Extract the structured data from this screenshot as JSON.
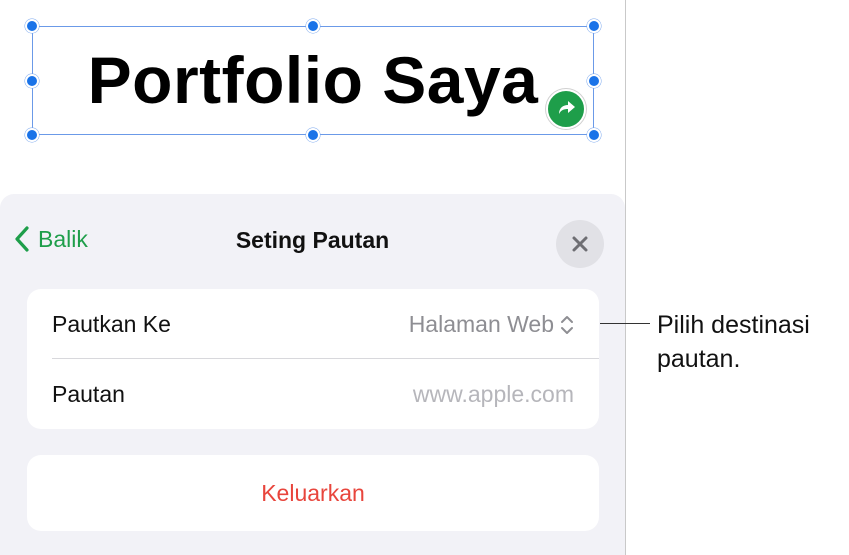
{
  "canvas": {
    "title": "Portfolio Saya",
    "link_badge_icon": "arrow-forward-icon"
  },
  "sheet": {
    "back_label": "Balik",
    "title": "Seting Pautan",
    "close_icon": "close-icon",
    "rows": [
      {
        "label": "Pautkan Ke",
        "value": "Halaman Web",
        "value_icon": "up-down-chevron-icon"
      },
      {
        "label": "Pautan",
        "placeholder": "www.apple.com"
      }
    ],
    "remove_label": "Keluarkan"
  },
  "callout": {
    "text": "Pilih destinasi pautan."
  },
  "colors": {
    "accent": "#1e9e4a",
    "selection": "#1a73e8",
    "destructive": "#e8453c"
  }
}
